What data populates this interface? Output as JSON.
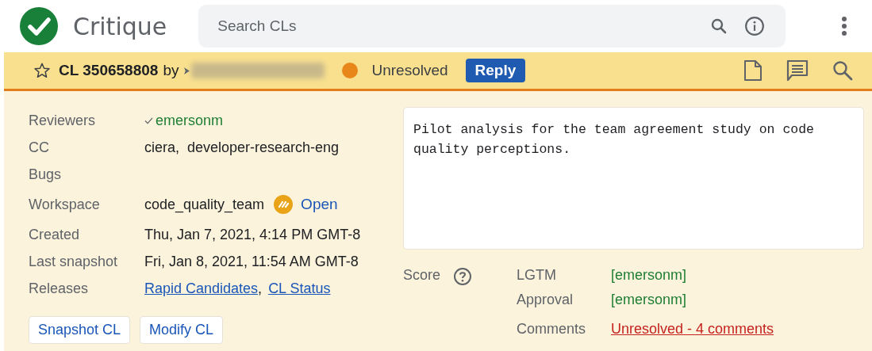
{
  "app": {
    "name": "Critique"
  },
  "search": {
    "placeholder": "Search CLs"
  },
  "cl_bar": {
    "starred": false,
    "title": "CL 350658808",
    "by": "by",
    "status": {
      "label": "Unresolved",
      "kind": "unresolved"
    },
    "reply_button": "Reply"
  },
  "fields": [
    {
      "label": "Reviewers",
      "kind": "reviewer",
      "value": "emersonm",
      "approved": true
    },
    {
      "label": "CC",
      "kind": "text",
      "value": "ciera,  developer-research-eng"
    },
    {
      "label": "Bugs",
      "kind": "text"
    },
    {
      "label": "Workspace",
      "kind": "workspace",
      "value": "code_quality_team",
      "link": "Open"
    },
    {
      "label": "Created",
      "kind": "text",
      "value": "Thu, Jan 7, 2021, 4:14 PM GMT-8"
    },
    {
      "label": "Last snapshot",
      "kind": "text",
      "value": "Fri, Jan 8, 2021, 11:54 AM GMT-8"
    },
    {
      "label": "Releases",
      "kind": "links",
      "links": [
        "Rapid Candidates",
        "CL Status"
      ],
      "separator": ","
    }
  ],
  "buttons": [
    "Snapshot CL",
    "Modify CL"
  ],
  "description": "Pilot analysis for the team agreement study on code quality perceptions.",
  "score": {
    "label": "Score",
    "rows": [
      {
        "label": "LGTM",
        "kind": "approved",
        "value": "[emersonm]"
      },
      {
        "label": "Approval",
        "kind": "approved",
        "value": "[emersonm]"
      },
      {
        "label": "Comments",
        "kind": "unresolved",
        "value": "Unresolved - 4 comments"
      }
    ]
  }
}
